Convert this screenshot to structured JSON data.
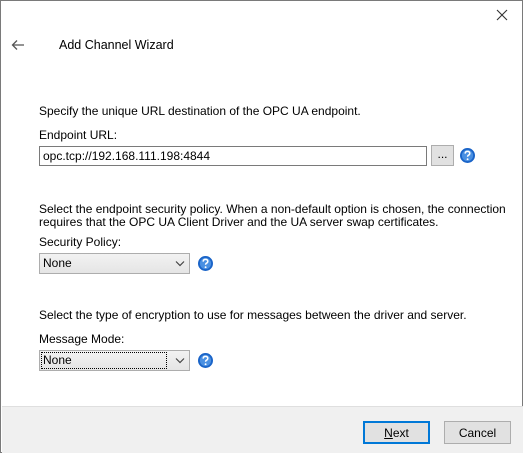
{
  "window": {
    "title": "Add Channel Wizard",
    "close_icon": "close-icon",
    "back_icon": "back-arrow-icon"
  },
  "endpoint": {
    "description": "Specify the unique URL destination of the OPC UA endpoint.",
    "label": "Endpoint URL:",
    "value": "opc.tcp://192.168.111.198:4844",
    "browse_label": "...",
    "help_icon": "help-icon"
  },
  "security": {
    "description_line1": "Select the endpoint security policy. When a non-default option is chosen, the connection",
    "description_line2": "requires that the OPC UA Client Driver and the UA server swap certificates.",
    "label": "Security Policy:",
    "selected": "None",
    "help_icon": "help-icon"
  },
  "message": {
    "description": "Select the type of encryption to use for messages between the driver and server.",
    "label": "Message Mode:",
    "selected": "None",
    "help_icon": "help-icon"
  },
  "footer": {
    "next_mnemonic": "N",
    "next_rest": "ext",
    "cancel_label": "Cancel"
  },
  "colors": {
    "help_blue": "#1a64c8",
    "default_button_border": "#0078d7",
    "footer_bg": "#f0f0f0"
  }
}
